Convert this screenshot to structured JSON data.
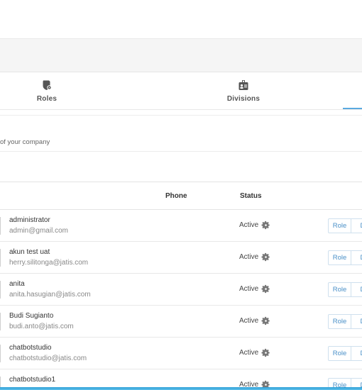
{
  "tabs": [
    {
      "label": "Roles",
      "icon": "roles-icon"
    },
    {
      "label": "Divisions",
      "icon": "id-badge-icon"
    }
  ],
  "description": "of your company",
  "table": {
    "headers": {
      "phone": "Phone",
      "status": "Status"
    },
    "rows": [
      {
        "name": "administrator",
        "email": "admin@gmail.com",
        "status": "Active",
        "role_label": "Role",
        "division_label": "Di"
      },
      {
        "name": "akun test uat",
        "email": "herry.silitonga@jatis.com",
        "status": "Active",
        "role_label": "Role",
        "division_label": "Di"
      },
      {
        "name": "anita",
        "email": "anita.hasugian@jatis.com",
        "status": "Active",
        "role_label": "Role",
        "division_label": "Di"
      },
      {
        "name": "Budi Sugianto",
        "email": "budi.anto@jatis.com",
        "status": "Active",
        "role_label": "Role",
        "division_label": "Di"
      },
      {
        "name": "chatbotstudio",
        "email": "chatbotstudio@jatis.com",
        "status": "Active",
        "role_label": "Role",
        "division_label": "Di"
      },
      {
        "name": "chatbotstudio1",
        "email": "",
        "status": "Active",
        "role_label": "Role",
        "division_label": "Di"
      }
    ]
  },
  "colors": {
    "accent": "#4a90c8",
    "underline": "#5aa9e0",
    "stripe": "#2e9fd6"
  }
}
